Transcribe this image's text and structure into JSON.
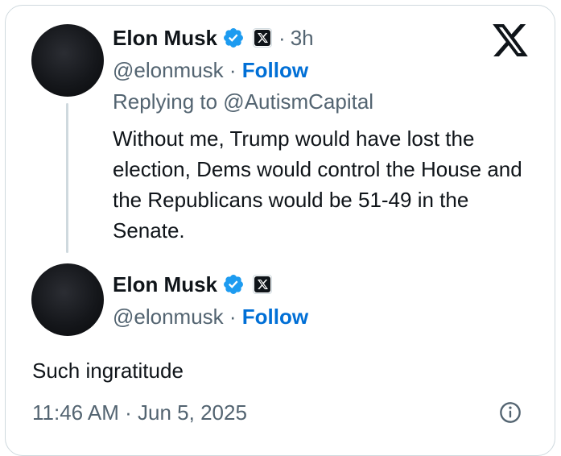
{
  "parent_tweet": {
    "author_name": "Elon Musk",
    "handle": "@elonmusk",
    "follow_label": "Follow",
    "relative_time": "3h",
    "separator": "·",
    "replying_to": "Replying to @AutismCapital",
    "text": "Without me, Trump would have lost the election, Dems would control the House and the Republicans would be 51-49 in the Senate."
  },
  "main_tweet": {
    "author_name": "Elon Musk",
    "handle": "@elonmusk",
    "follow_label": "Follow",
    "separator": "·",
    "text": "Such ingratitude",
    "timestamp": "11:46 AM · Jun 5, 2025"
  },
  "icons": {
    "brand": "x-logo-icon",
    "verified": "verified-badge-icon",
    "affiliation": "x-affiliation-icon",
    "info": "info-icon"
  },
  "colors": {
    "verified_blue": "#1d9bf0",
    "follow_blue": "#006fd6",
    "muted_text": "#536471",
    "primary_text": "#0f1419"
  }
}
